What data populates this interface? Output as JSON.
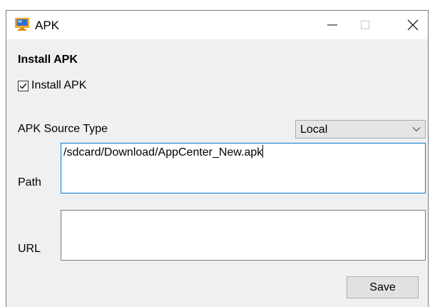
{
  "window": {
    "title": "APK",
    "icon": "monitor-app-icon"
  },
  "controls": {
    "minimize": "minimize-icon",
    "maximize": "maximize-icon",
    "close": "close-icon"
  },
  "form": {
    "group_title": "Install APK",
    "install_checkbox": {
      "label": "Install APK",
      "checked": true
    },
    "source_type": {
      "label": "APK Source Type",
      "selected": "Local"
    },
    "path": {
      "label": "Path",
      "value": "/sdcard/Download/AppCenter_New.apk"
    },
    "url": {
      "label": "URL",
      "value": ""
    },
    "save_label": "Save"
  },
  "colors": {
    "focus_border": "#0078d7",
    "window_bg": "#f0f0f0",
    "icon_orange": "#f5a623",
    "icon_blue": "#2f6fc9"
  }
}
